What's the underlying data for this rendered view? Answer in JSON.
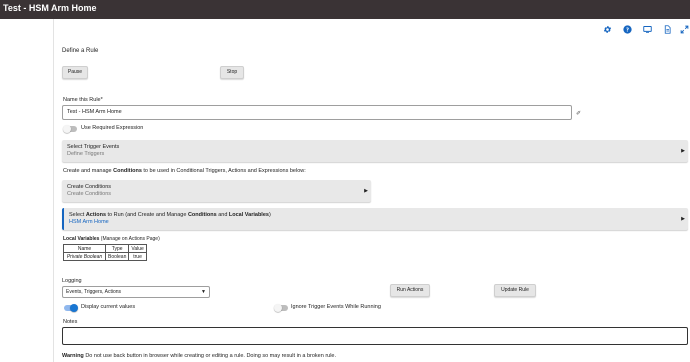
{
  "window": {
    "title": "Test - HSM Arm Home"
  },
  "toolbar": {
    "icons": [
      "gear-icon",
      "help-icon",
      "monitor-icon",
      "document-icon",
      "expand-icon"
    ]
  },
  "page": {
    "heading": "Define a Rule",
    "pause_label": "Pause",
    "stop_label": "Stop"
  },
  "rule_name": {
    "label": "Name this Rule*",
    "value": "Test - HSM Arm Home"
  },
  "required_expression": {
    "label": "Use Required Expression",
    "on": false
  },
  "triggers": {
    "title": "Select Trigger Events",
    "subtitle": "Define Triggers"
  },
  "conditions_intro": {
    "before": "Create and manage ",
    "bold": "Conditions",
    "after": " to be used in Conditional Triggers, Actions and Expressions below:"
  },
  "conditions": {
    "title": "Create Conditions",
    "subtitle": "Create Conditions"
  },
  "actions": {
    "title_1": "Select ",
    "title_bold_1": "Actions",
    "title_2": " to Run (and Create and Manage ",
    "title_bold_2": "Conditions",
    "title_3": " and ",
    "title_bold_3": "Local Variables",
    "title_4": ")",
    "subtitle": "HSM Arm Home"
  },
  "local_variables": {
    "label": "Local Variables",
    "note": " (Manage on Actions Page)",
    "headers": [
      "Name",
      "Type",
      "Value"
    ],
    "rows": [
      [
        "Private Boolean",
        "Boolean",
        "true"
      ]
    ]
  },
  "logging": {
    "label": "Logging",
    "selected": "Events, Triggers, Actions",
    "run_actions_label": "Run Actions",
    "update_rule_label": "Update Rule"
  },
  "display_values": {
    "label": "Display current values",
    "on": true
  },
  "ignore_triggers": {
    "label": "Ignore Trigger Events While Running",
    "on": false
  },
  "notes": {
    "label": "Notes",
    "value": ""
  },
  "warning": {
    "bold": "Warning",
    "text": " Do not use back button in browser while creating or editing a rule. Doing so may result in a broken rule."
  },
  "colors": {
    "titlebar": "#3a3335",
    "accent": "#1565c0",
    "panel": "#e8e8e8"
  }
}
